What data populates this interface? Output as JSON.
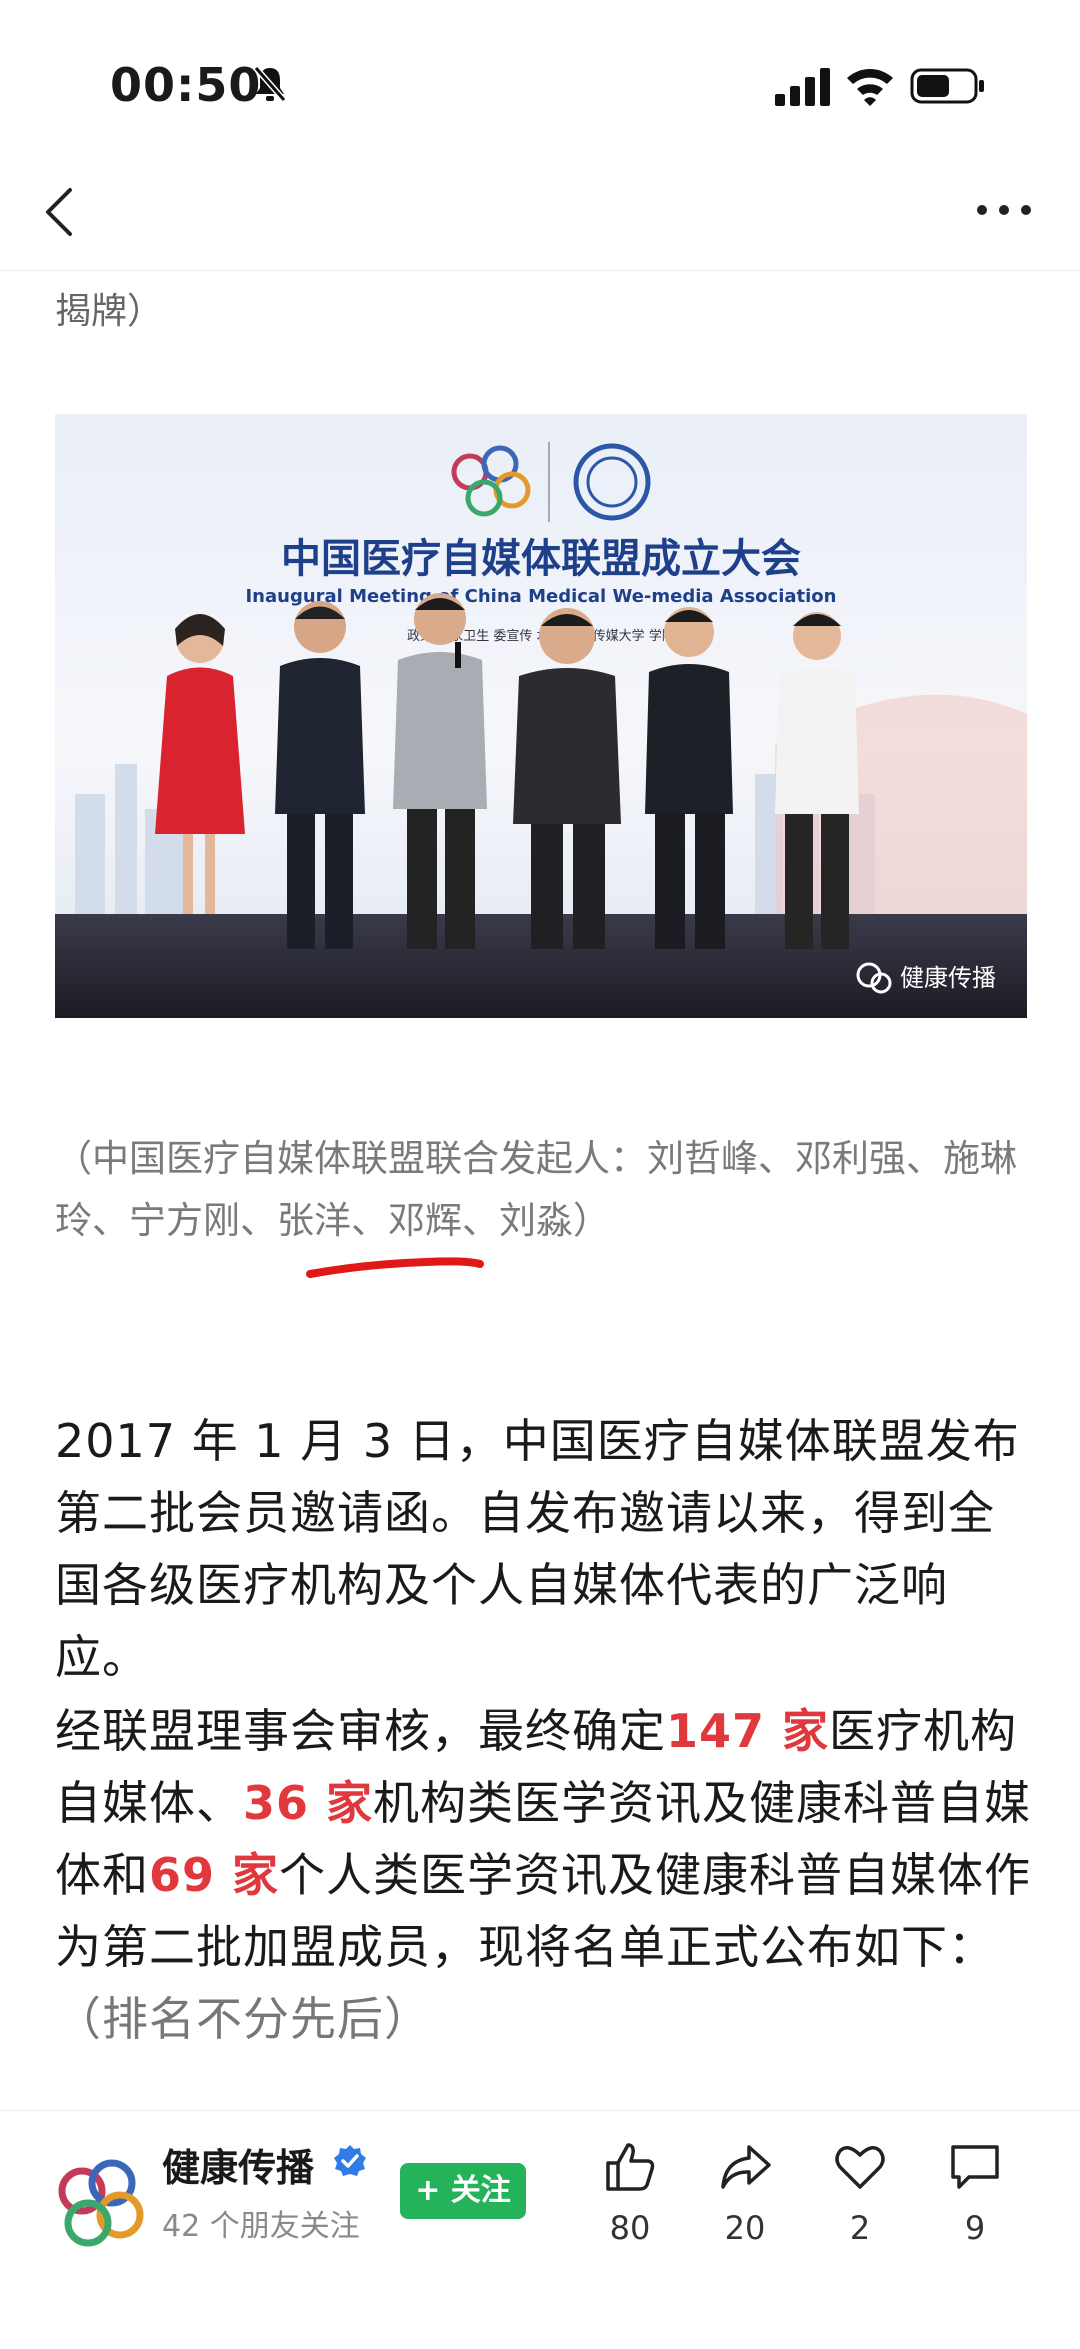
{
  "status_bar": {
    "time": "00:50"
  },
  "article": {
    "top_fragment": "揭牌）",
    "image": {
      "banner_cn": "中国医疗自媒体联盟成立大会",
      "banner_en": "Inaugural Meeting of China Medical We-media Association",
      "banner_small": "政策 国家卫生 委宣传 术支持： 传媒大学 学院",
      "watermark": "健康传播"
    },
    "caption": "（中国医疗自媒体联盟联合发起人：刘哲峰、邓利强、施琳玲、宁方刚、张洋、邓辉、刘淼）",
    "para1": "2017 年 1 月 3 日，中国医疗自媒体联盟发布第二批会员邀请函。自发布邀请以来，得到全国各级医疗机构及个人自媒体代表的广泛响应。",
    "para2": {
      "t1": "经联盟理事会审核，最终确定",
      "h1": "147 家",
      "t2": "医疗机构自媒体、",
      "h2": "36 家",
      "t3": "机构类医学资讯及健康科普自媒体和",
      "h3": "69 家",
      "t4": "个人类医学资讯及健康科普自媒体作为第二批加盟成员，现将名单正式公布如下：",
      "t5": "（排名不分先后）"
    }
  },
  "bottom_bar": {
    "account_name": "健康传播",
    "followers": "42 个朋友关注",
    "follow_label": "+ 关注",
    "actions": [
      {
        "icon": "thumbs-up-icon",
        "count": "80"
      },
      {
        "icon": "share-icon",
        "count": "20"
      },
      {
        "icon": "heart-icon",
        "count": "2"
      },
      {
        "icon": "comment-icon",
        "count": "9"
      }
    ]
  },
  "colors": {
    "highlight": "#e0383c",
    "follow_button": "#24b35a",
    "verified": "#2f7ce8"
  }
}
